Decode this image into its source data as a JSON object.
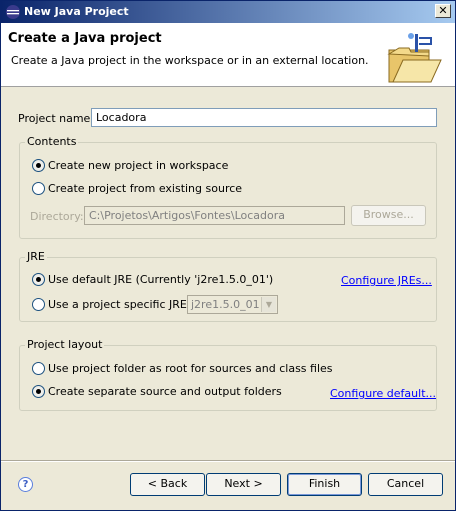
{
  "window": {
    "title": "New Java Project",
    "close_glyph": "✕"
  },
  "header": {
    "title": "Create a Java project",
    "description": "Create a Java project in the workspace or in an external location."
  },
  "project_name": {
    "label": "Project name:",
    "value": "Locadora"
  },
  "contents": {
    "title": "Contents",
    "option_new": "Create new project in workspace",
    "option_existing": "Create project from existing source",
    "directory_label": "Directory:",
    "directory_value": "C:\\Projetos\\Artigos\\Fontes\\Locadora",
    "browse_label": "Browse..."
  },
  "jre": {
    "title": "JRE",
    "option_default": "Use default JRE (Currently 'j2re1.5.0_01')",
    "option_specific": "Use a project specific JRE:",
    "specific_value": "j2re1.5.0_01",
    "configure_link": "Configure JREs..."
  },
  "project_layout": {
    "title": "Project layout",
    "option_root": "Use project folder as root for sources and class files",
    "option_separate": "Create separate source and output folders",
    "configure_link": "Configure default..."
  },
  "buttons": {
    "back": "< Back",
    "next": "Next >",
    "finish": "Finish",
    "cancel": "Cancel",
    "help_glyph": "?"
  }
}
